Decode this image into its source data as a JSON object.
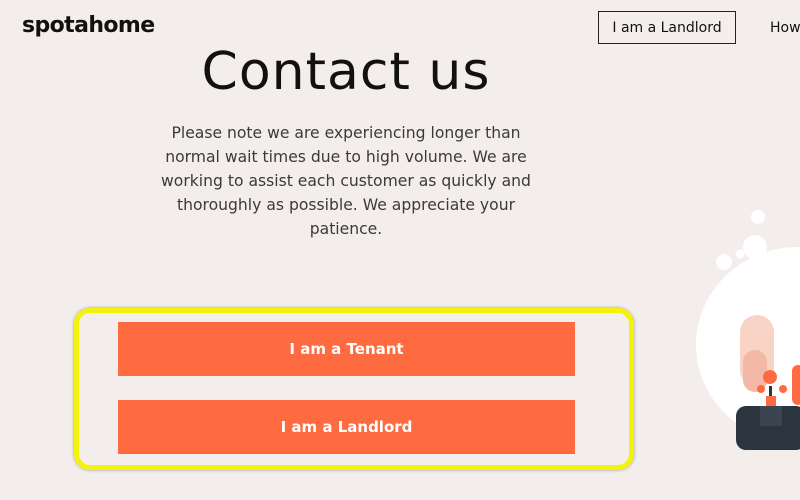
{
  "header": {
    "logo": "spotahome",
    "landlord_nav_label": "I am a Landlord",
    "how_link": "How"
  },
  "main": {
    "title": "Contact us",
    "notice": "Please note we are experiencing longer than normal wait times due to high volume. We are working to assist each customer as quickly and thoroughly as possible. We appreciate your patience."
  },
  "actions": {
    "tenant_label": "I am a Tenant",
    "landlord_label": "I am a Landlord"
  },
  "colors": {
    "background": "#f3eeeb",
    "accent": "#ff6b40",
    "highlight": "#f2f20a"
  }
}
